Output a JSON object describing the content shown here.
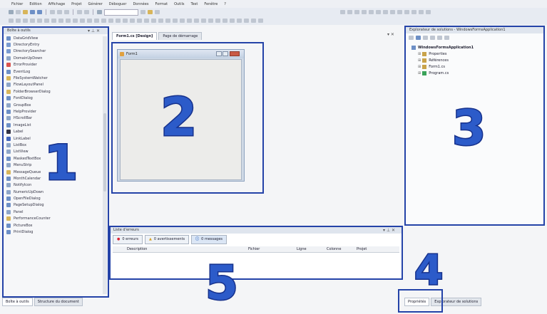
{
  "menu": [
    "Fichier",
    "Edition",
    "Affichage",
    "Projet",
    "Générer",
    "Déboguer",
    "Données",
    "Format",
    "Outils",
    "Test",
    "Fenêtre",
    "?"
  ],
  "toolbox": {
    "title": "Boîte à outils",
    "items": [
      {
        "label": "DataGridView",
        "color": "#6d8fc6"
      },
      {
        "label": "DirectoryEntry",
        "color": "#7a9bd0"
      },
      {
        "label": "DirectorySearcher",
        "color": "#7a9bd0"
      },
      {
        "label": "DomainUpDown",
        "color": "#8fa6c8"
      },
      {
        "label": "ErrorProvider",
        "color": "#d9534f"
      },
      {
        "label": "EventLog",
        "color": "#6d8fc6"
      },
      {
        "label": "FileSystemWatcher",
        "color": "#d8b55a"
      },
      {
        "label": "FlowLayoutPanel",
        "color": "#8fa6c8"
      },
      {
        "label": "FolderBrowserDialog",
        "color": "#d8b55a"
      },
      {
        "label": "FontDialog",
        "color": "#6d8fc6"
      },
      {
        "label": "GroupBox",
        "color": "#8fa6c8"
      },
      {
        "label": "HelpProvider",
        "color": "#6d8fc6"
      },
      {
        "label": "HScrollBar",
        "color": "#8fa6c8"
      },
      {
        "label": "ImageList",
        "color": "#6d8fc6"
      },
      {
        "label": "Label",
        "color": "#333344"
      },
      {
        "label": "LinkLabel",
        "color": "#4466bb"
      },
      {
        "label": "ListBox",
        "color": "#8fa6c8"
      },
      {
        "label": "ListView",
        "color": "#8fa6c8"
      },
      {
        "label": "MaskedTextBox",
        "color": "#6d8fc6"
      },
      {
        "label": "MenuStrip",
        "color": "#8fa6c8"
      },
      {
        "label": "MessageQueue",
        "color": "#d8b55a"
      },
      {
        "label": "MonthCalendar",
        "color": "#6d8fc6"
      },
      {
        "label": "NotifyIcon",
        "color": "#8fa6c8"
      },
      {
        "label": "NumericUpDown",
        "color": "#8fa6c8"
      },
      {
        "label": "OpenFileDialog",
        "color": "#6d8fc6"
      },
      {
        "label": "PageSetupDialog",
        "color": "#6d8fc6"
      },
      {
        "label": "Panel",
        "color": "#8fa6c8"
      },
      {
        "label": "PerformanceCounter",
        "color": "#d8b55a"
      },
      {
        "label": "PictureBox",
        "color": "#6d8fc6"
      },
      {
        "label": "PrintDialog",
        "color": "#6d8fc6"
      }
    ]
  },
  "doc_tabs": [
    "Form1.cs [Design]",
    "Page de démarrage"
  ],
  "form_title": "Form1",
  "solution": {
    "title": "Explorateur de solutions - WindowsFormsApplication1",
    "nodes": [
      {
        "label": "WindowsFormsApplication1",
        "indent": 0,
        "bold": true
      },
      {
        "label": "Properties",
        "indent": 1,
        "bold": false
      },
      {
        "label": "Références",
        "indent": 1,
        "bold": false
      },
      {
        "label": "Form1.cs",
        "indent": 1,
        "bold": false
      },
      {
        "label": "Program.cs",
        "indent": 1,
        "bold": false
      }
    ]
  },
  "errors": {
    "title": "Liste d'erreurs",
    "tabs": [
      "0 erreurs",
      "0 avertissements",
      "0 messages"
    ],
    "columns": [
      "Description",
      "Fichier",
      "Ligne",
      "Colonne",
      "Projet"
    ]
  },
  "bottom_tabs_left": [
    "Boîte à outils",
    "Structure du document"
  ],
  "bottom_tabs_right": [
    "Propriétés",
    "Explorateur de solutions"
  ],
  "annotations": [
    "1",
    "2",
    "3",
    "4",
    "5"
  ]
}
